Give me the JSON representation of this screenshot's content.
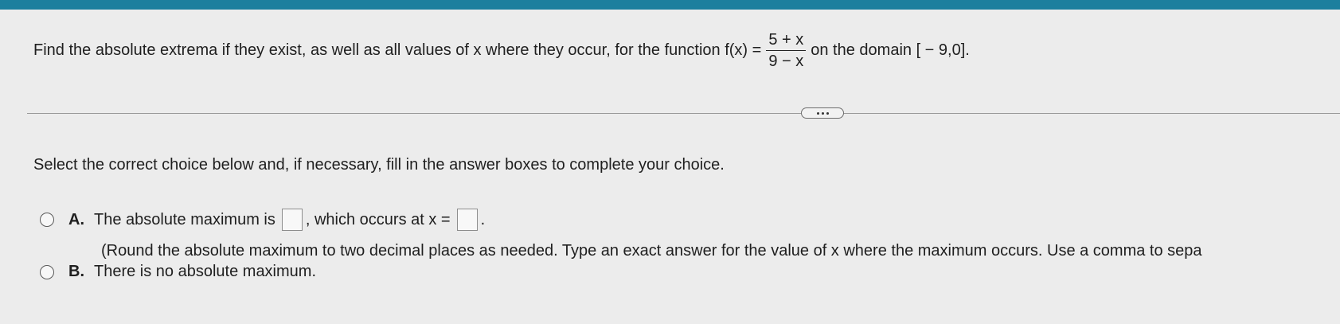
{
  "question": {
    "prefix": "Find the absolute extrema if they exist, as well as all values of x where they occur, for the function f(x) =",
    "fraction_numerator": "5 + x",
    "fraction_denominator": "9 − x",
    "suffix": "on the domain [ − 9,0]."
  },
  "more_button_icon": "ellipsis-icon",
  "instruction": "Select the correct choice below and, if necessary, fill in the answer boxes to complete your choice.",
  "option_a": {
    "letter": "A.",
    "text_before": "The absolute maximum is",
    "text_middle": ", which occurs at x =",
    "text_after": ".",
    "note": "(Round the absolute maximum to two decimal places as needed. Type an exact answer for the value of x where the maximum occurs. Use a comma to sepa"
  },
  "option_b": {
    "letter": "B.",
    "text": "There is no absolute maximum."
  },
  "colors": {
    "top_bar": "#1c7f9e",
    "background": "#ececec"
  }
}
